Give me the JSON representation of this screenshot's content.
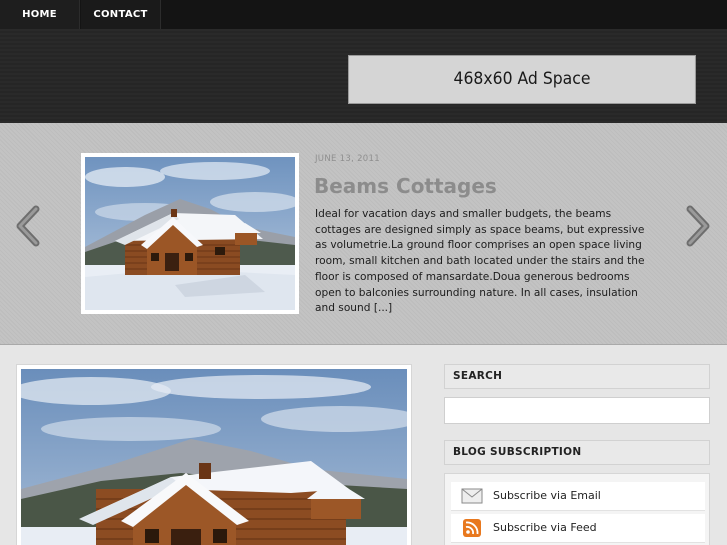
{
  "nav": {
    "items": [
      {
        "label": "HOME"
      },
      {
        "label": "CONTACT"
      }
    ]
  },
  "header": {
    "ad_label": "468x60 Ad Space"
  },
  "slider": {
    "date": "JUNE 13, 2011",
    "title": "Beams Cottages",
    "excerpt": "Ideal for vacation days and smaller budgets, the beams cottages are designed simply as space beams, but expressive as volumetrie.La ground floor comprises an open space living room, small kitchen and bath located under the stairs and the floor is composed of mansardate.Doua generous bedrooms open to balconies surrounding nature. In all cases, insulation and sound [...]",
    "prev_icon": "chevron-left-icon",
    "next_icon": "chevron-right-icon"
  },
  "sidebar": {
    "search": {
      "title": "SEARCH",
      "value": "",
      "placeholder": ""
    },
    "subscription": {
      "title": "BLOG SUBSCRIPTION",
      "items": [
        {
          "label": "Subscribe via Email",
          "icon": "envelope-icon"
        },
        {
          "label": "Subscribe via Feed",
          "icon": "rss-icon"
        }
      ]
    }
  },
  "colors": {
    "nav_bg": "#141414",
    "header_bg": "#2a2a2a",
    "slider_bg": "#c0c0c0",
    "title_gray": "#8c8c8c",
    "rss_orange": "#e8781e"
  }
}
